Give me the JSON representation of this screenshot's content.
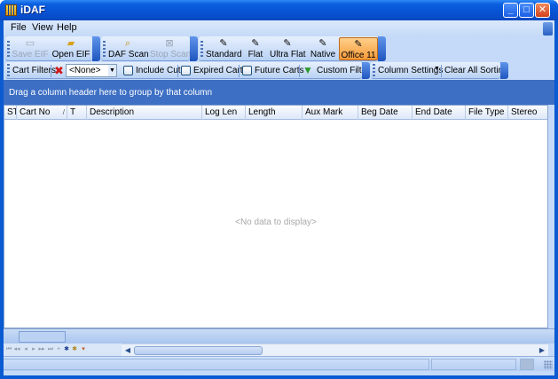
{
  "window": {
    "title": "iDAF",
    "minimize_icon": "minimize-icon",
    "maximize_icon": "maximize-icon",
    "close_icon": "close-icon"
  },
  "menu": {
    "items": [
      {
        "label": "File"
      },
      {
        "label": "View"
      },
      {
        "label": "Help"
      }
    ]
  },
  "toolbars": {
    "file": {
      "save_eif": "Save EIF",
      "open_eif": "Open EIF"
    },
    "scan": {
      "daf_scan": "DAF Scan",
      "stop_scan": "Stop Scan"
    },
    "styles": {
      "standard": "Standard",
      "flat": "Flat",
      "ultra_flat": "Ultra Flat",
      "native": "Native",
      "office11": "Office 11",
      "active": "Office 11"
    }
  },
  "filters": {
    "cart_filters_label": "Cart Filters",
    "combo_value": "<None>",
    "include_cuts": {
      "label": "Include Cuts",
      "checked": false
    },
    "expired_carts": {
      "label": "Expired Carts",
      "checked": false
    },
    "future_carts": {
      "label": "Future Carts",
      "checked": false
    },
    "custom_filter": "Custom Filter",
    "column_settings": "Column Settings",
    "clear_all_sorting": "Clear All Sorting"
  },
  "group_panel": {
    "hint": "Drag a column header here to group by that column"
  },
  "grid": {
    "columns": [
      "ST",
      "Cart No",
      "T",
      "Description",
      "Log Len",
      "Length",
      "Aux Mark",
      "Beg Date",
      "End Date",
      "File Type",
      "Stereo"
    ],
    "sorted_column": "Cart No",
    "no_data": "<No data to display>"
  },
  "colors": {
    "title_bar": "#0753d4",
    "group_panel": "#3d6fc4",
    "active_style": "#f59a3a",
    "client_bg": "#c4daf8"
  }
}
